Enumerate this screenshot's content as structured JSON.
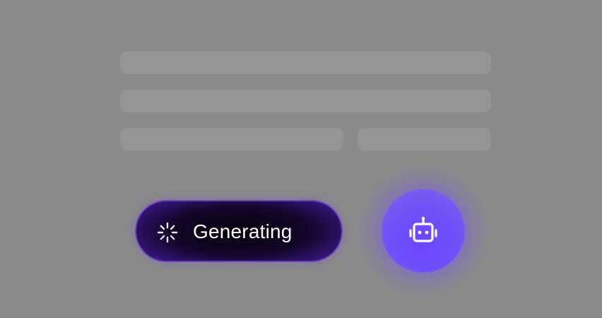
{
  "generate_button": {
    "label": "Generating",
    "state": "loading",
    "spinner_icon": "loading-spinner-icon",
    "background_color": "#0a0318",
    "border_color": "#6a43b8"
  },
  "assistant_button": {
    "icon": "robot-icon",
    "background_color": "#6b4dff"
  },
  "colors": {
    "background": "#8a8a8a",
    "skeleton": "#949494",
    "text": "#ffffff"
  }
}
